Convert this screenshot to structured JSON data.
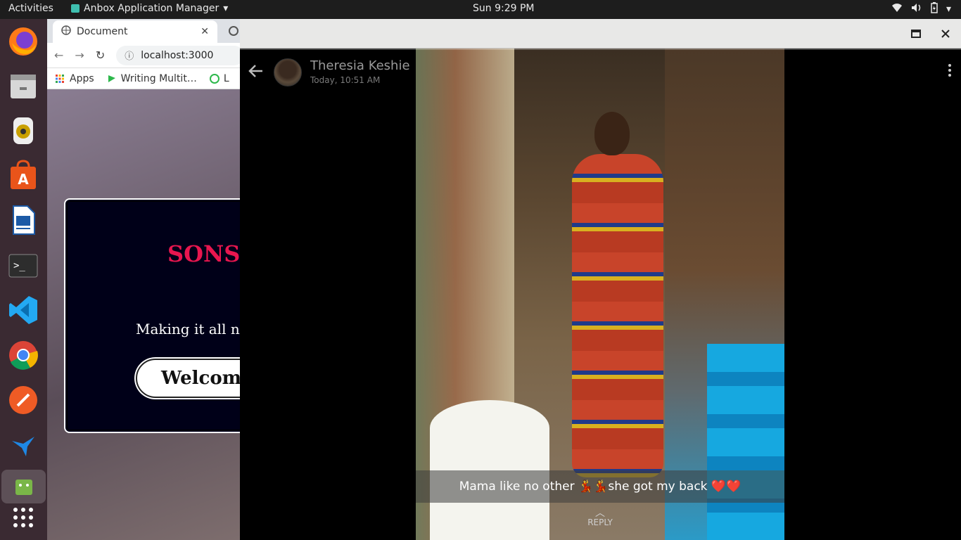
{
  "topbar": {
    "activities": "Activities",
    "app_name": "Anbox Application Manager",
    "clock": "Sun  9:29 PM"
  },
  "dock": {
    "items": [
      "firefox-icon",
      "files-icon",
      "rhythmbox-icon",
      "software-center-icon",
      "writer-icon",
      "terminal-icon",
      "vscode-icon",
      "chrome-icon",
      "postman-icon",
      "bird-app-icon",
      "anbox-icon",
      "app-grid-icon"
    ]
  },
  "browser": {
    "tab_title": "Document",
    "url": "localhost:3000",
    "bookmarks": {
      "apps": "Apps",
      "writing": "Writing Multit…",
      "third": "L"
    },
    "page": {
      "brand": "SONSM",
      "tagline": "Making it all ne",
      "welcome": "Welcome"
    }
  },
  "story": {
    "sender": "Theresia Keshie",
    "timestamp": "Today, 10:51 AM",
    "caption": "Mama like no other 💃💃she got my back ❤️❤️",
    "reply": "REPLY"
  },
  "colors": {
    "brand": "#e8164f",
    "topbar": "#1d1d1d",
    "dock": "#3a2a32"
  }
}
